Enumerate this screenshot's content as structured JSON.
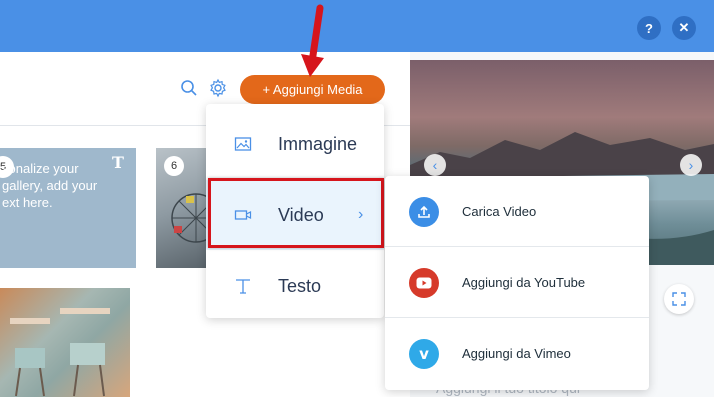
{
  "header": {
    "help_label": "?",
    "close_label": "✕"
  },
  "toolbar": {
    "add_media_label": "+ Aggiungi Media"
  },
  "gallery": {
    "tile_text": {
      "badge": "5",
      "caption": "sonalize your gallery, add your ext here."
    },
    "tile_photo": {
      "badge": "6"
    }
  },
  "media_menu": {
    "items": [
      {
        "label": "Immagine",
        "icon": "image-icon"
      },
      {
        "label": "Video",
        "icon": "video-icon",
        "chevron": "›"
      },
      {
        "label": "Testo",
        "icon": "text-icon"
      }
    ]
  },
  "video_submenu": {
    "items": [
      {
        "label": "Carica Video",
        "icon": "upload-icon",
        "color": "#3b8ee6"
      },
      {
        "label": "Aggiungi da YouTube",
        "icon": "youtube-icon",
        "color": "#d63a2a"
      },
      {
        "label": "Aggiungi da Vimeo",
        "icon": "vimeo-icon",
        "color": "#2fa9e8"
      }
    ]
  },
  "preview": {
    "title_placeholder": "Aggiungi il tuo titolo qui"
  },
  "colors": {
    "topbar": "#4a90e6",
    "accent_orange": "#e3681a",
    "highlight_red": "#d6151c"
  }
}
